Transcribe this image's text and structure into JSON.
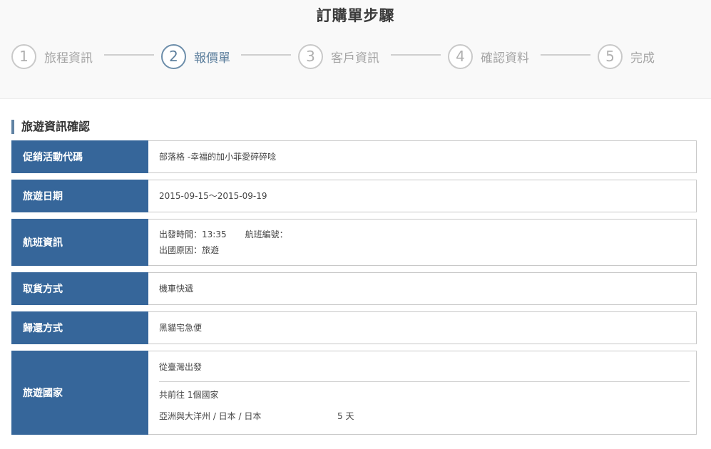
{
  "page_title": "訂購單步驟",
  "steps": [
    {
      "number": "1",
      "label": "旅程資訊",
      "active": false
    },
    {
      "number": "2",
      "label": "報價單",
      "active": true
    },
    {
      "number": "3",
      "label": "客戶資訊",
      "active": false
    },
    {
      "number": "4",
      "label": "確認資料",
      "active": false
    },
    {
      "number": "5",
      "label": "完成",
      "active": false
    }
  ],
  "section_title": "旅遊資訊確認",
  "rows": {
    "promo": {
      "label": "促銷活動代碼",
      "value": "部落格 -幸福的加小菲愛碎碎唸"
    },
    "travel_date": {
      "label": "旅遊日期",
      "value": "2015-09-15～2015-09-19"
    },
    "flight": {
      "label": "航班資訊",
      "departure_time_label": "出發時間：",
      "departure_time": "13:35",
      "flight_number_label": "航班編號：",
      "flight_number": "",
      "purpose_label": "出國原因：",
      "purpose": "旅遊"
    },
    "pickup": {
      "label": "取貨方式",
      "value": "機車快遞"
    },
    "return": {
      "label": "歸還方式",
      "value": "黑貓宅急便"
    },
    "country": {
      "label": "旅遊國家",
      "departure": "從臺灣出發",
      "count_text": "共前往 1個國家",
      "route": "亞洲與大洋州 / 日本 / 日本",
      "days": "5 天"
    }
  }
}
